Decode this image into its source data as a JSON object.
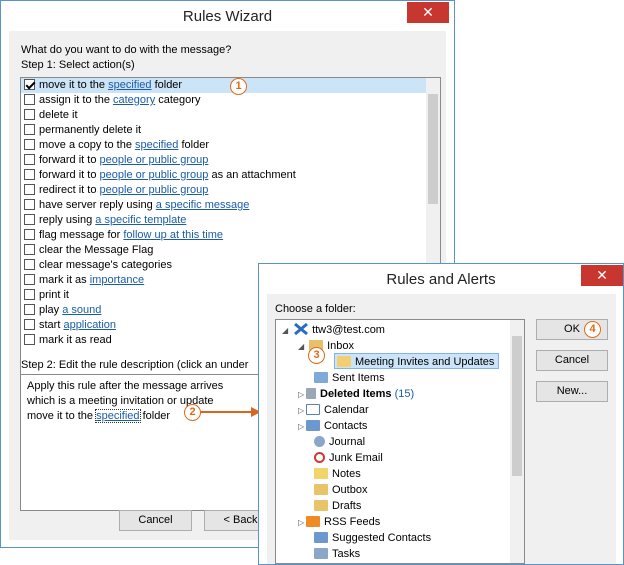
{
  "wizard": {
    "title": "Rules Wizard",
    "question": "What do you want to do with the message?",
    "step1": "Step 1: Select action(s)",
    "actions": [
      {
        "pre": "move it to the ",
        "link": "specified",
        "post": " folder",
        "checked": true,
        "selected": true
      },
      {
        "pre": "assign it to the ",
        "link": "category",
        "post": " category",
        "checked": false
      },
      {
        "pre": "delete it",
        "link": "",
        "post": "",
        "checked": false
      },
      {
        "pre": "permanently delete it",
        "link": "",
        "post": "",
        "checked": false
      },
      {
        "pre": "move a copy to the ",
        "link": "specified",
        "post": " folder",
        "checked": false
      },
      {
        "pre": "forward it to ",
        "link": "people or public group",
        "post": "",
        "checked": false
      },
      {
        "pre": "forward it to ",
        "link": "people or public group",
        "post": " as an attachment",
        "checked": false
      },
      {
        "pre": "redirect it to ",
        "link": "people or public group",
        "post": "",
        "checked": false
      },
      {
        "pre": "have server reply using ",
        "link": "a specific message",
        "post": "",
        "checked": false
      },
      {
        "pre": "reply using ",
        "link": "a specific template",
        "post": "",
        "checked": false
      },
      {
        "pre": "flag message for ",
        "link": "follow up at this time",
        "post": "",
        "checked": false
      },
      {
        "pre": "clear the Message Flag",
        "link": "",
        "post": "",
        "checked": false
      },
      {
        "pre": "clear message's categories",
        "link": "",
        "post": "",
        "checked": false
      },
      {
        "pre": "mark it as ",
        "link": "importance",
        "post": "",
        "checked": false
      },
      {
        "pre": "print it",
        "link": "",
        "post": "",
        "checked": false
      },
      {
        "pre": "play ",
        "link": "a sound",
        "post": "",
        "checked": false
      },
      {
        "pre": "start ",
        "link": "application",
        "post": "",
        "checked": false
      },
      {
        "pre": "mark it as read",
        "link": "",
        "post": "",
        "checked": false
      }
    ],
    "step2": "Step 2: Edit the rule description (click an under",
    "desc_line1": "Apply this rule after the message arrives",
    "desc_line2": "which is a meeting invitation or update",
    "desc_line3_pre": "move it to the ",
    "desc_line3_link": "specified",
    "desc_line3_post": " folder",
    "cancel": "Cancel",
    "back": "< Back"
  },
  "alerts": {
    "title": "Rules and Alerts",
    "choose": "Choose a folder:",
    "ok": "OK",
    "cancel": "Cancel",
    "new": "New...",
    "tree": {
      "account": "ttw3@test.com",
      "inbox": "Inbox",
      "meeting": "Meeting Invites and Updates",
      "sent": "Sent Items",
      "deleted": "Deleted Items",
      "deleted_count": "(15)",
      "calendar": "Calendar",
      "contacts": "Contacts",
      "journal": "Journal",
      "junk": "Junk Email",
      "notes": "Notes",
      "outbox": "Outbox",
      "drafts": "Drafts",
      "rss": "RSS Feeds",
      "suggested": "Suggested Contacts",
      "tasks": "Tasks"
    }
  },
  "annotations": {
    "b1": "1",
    "b2": "2",
    "b3": "3",
    "b4": "4"
  },
  "colors": {
    "badge": "#e06a1a",
    "link": "#1a5ca8",
    "selection": "#cce4f7",
    "close": "#c7372f"
  }
}
